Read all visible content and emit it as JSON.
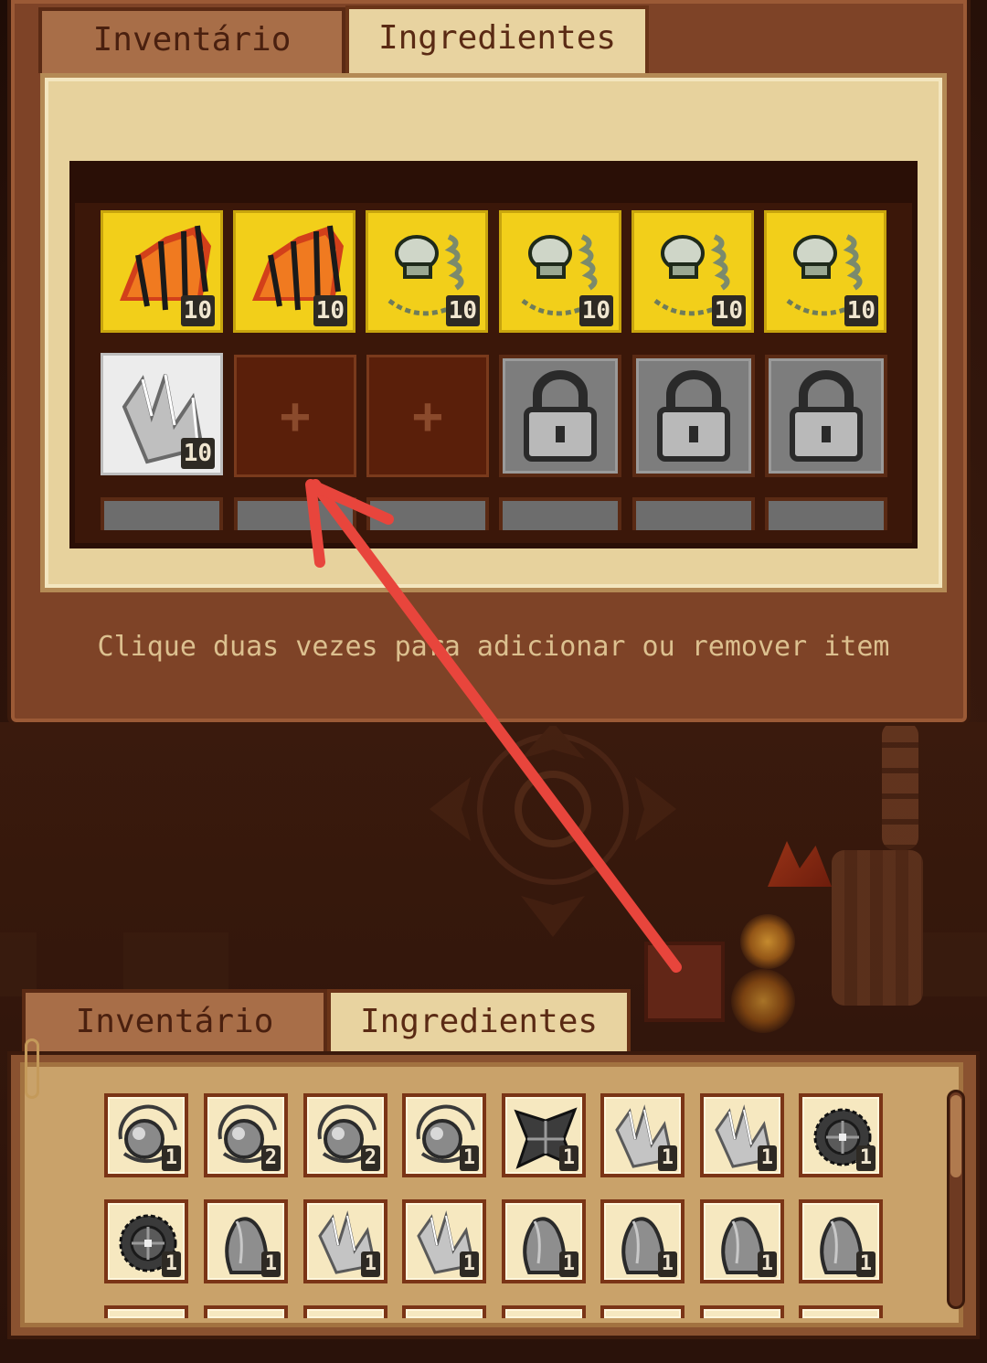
{
  "top_panel": {
    "tabs": [
      {
        "label": "Inventário",
        "active": false
      },
      {
        "label": "Ingredientes",
        "active": true
      }
    ],
    "slots_row1": [
      {
        "icon": "dragon-wing-icon",
        "count": "10"
      },
      {
        "icon": "dragon-wing-icon",
        "count": "10"
      },
      {
        "icon": "skeleton-icon",
        "count": "10"
      },
      {
        "icon": "skeleton-icon",
        "count": "10"
      },
      {
        "icon": "skeleton-icon",
        "count": "10"
      },
      {
        "icon": "skeleton-icon",
        "count": "10"
      }
    ],
    "slots_row2": [
      {
        "icon": "crystal-shard-icon",
        "count": "10"
      },
      {
        "state": "empty",
        "symbol": "+"
      },
      {
        "state": "empty",
        "symbol": "+"
      },
      {
        "state": "locked"
      },
      {
        "state": "locked"
      },
      {
        "state": "locked"
      }
    ],
    "hint": "Clique duas vezes para adicionar ou remover item"
  },
  "bottom_panel": {
    "tabs": [
      {
        "label": "Inventário",
        "active": false
      },
      {
        "label": "Ingredientes",
        "active": true
      }
    ],
    "row1": [
      {
        "icon": "orb-icon",
        "count": "1"
      },
      {
        "icon": "orb-icon",
        "count": "2"
      },
      {
        "icon": "orb-icon",
        "count": "2"
      },
      {
        "icon": "orb-icon",
        "count": "1"
      },
      {
        "icon": "dark-crystal-icon",
        "count": "1"
      },
      {
        "icon": "crystal-shard-icon",
        "count": "1"
      },
      {
        "icon": "crystal-shard-icon",
        "count": "1"
      },
      {
        "icon": "spiked-shield-icon",
        "count": "1"
      }
    ],
    "row2": [
      {
        "icon": "spiked-shield-icon",
        "count": "1"
      },
      {
        "icon": "stone-horn-icon",
        "count": "1"
      },
      {
        "icon": "crystal-shard-icon",
        "count": "1"
      },
      {
        "icon": "crystal-shard-icon",
        "count": "1"
      },
      {
        "icon": "stone-horn-icon",
        "count": "1"
      },
      {
        "icon": "stone-horn-icon",
        "count": "1"
      },
      {
        "icon": "stone-horn-icon",
        "count": "1"
      },
      {
        "icon": "stone-horn-icon",
        "count": "1"
      }
    ]
  },
  "colors": {
    "annotation_arrow": "#e8453c",
    "slot_highlight": "#f2cf1a",
    "panel_cream": "#e7d29d",
    "panel_brown": "#7e4327"
  }
}
